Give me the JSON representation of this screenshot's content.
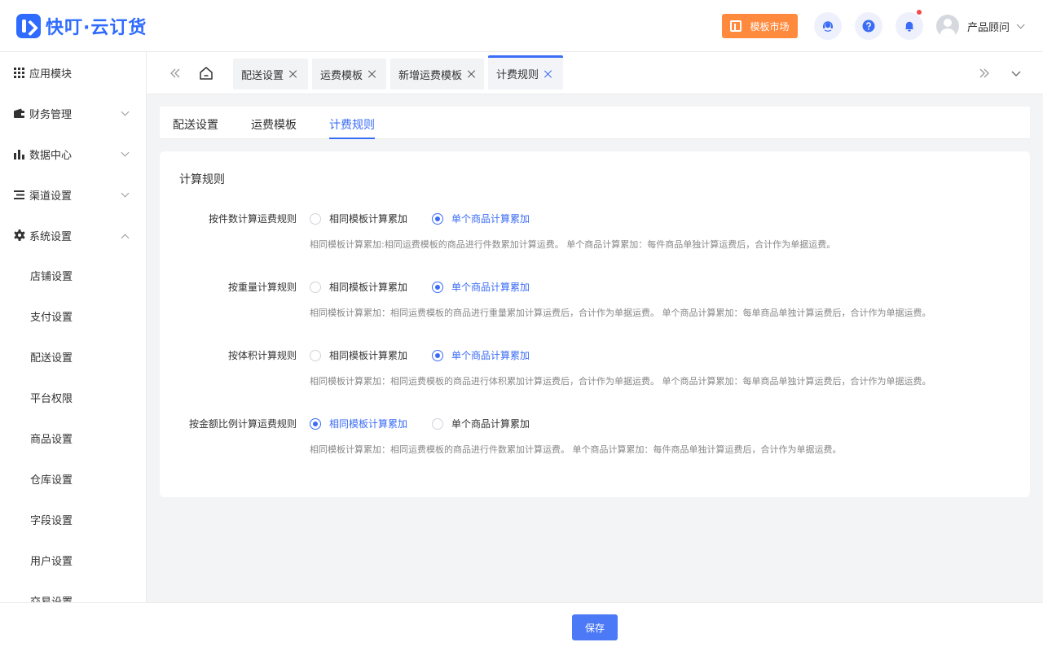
{
  "header": {
    "logo_text": "快叮·云订货",
    "market_label": "模板市场",
    "user_name": "产品顾问"
  },
  "sidebar": {
    "items": [
      {
        "label": "应用模块",
        "icon": "grid-icon"
      },
      {
        "label": "财务管理",
        "icon": "wallet-icon"
      },
      {
        "label": "数据中心",
        "icon": "bar-chart-icon"
      },
      {
        "label": "渠道设置",
        "icon": "list-icon"
      },
      {
        "label": "系统设置",
        "icon": "gear-icon"
      }
    ],
    "subitems": [
      "店铺设置",
      "支付设置",
      "配送设置",
      "平台权限",
      "商品设置",
      "仓库设置",
      "字段设置",
      "用户设置",
      "交易设置"
    ]
  },
  "tabs": [
    {
      "label": "配送设置"
    },
    {
      "label": "运费模板"
    },
    {
      "label": "新增运费模板"
    },
    {
      "label": "计费规则"
    }
  ],
  "subtabs": [
    {
      "label": "配送设置"
    },
    {
      "label": "运费模板"
    },
    {
      "label": "计费规则"
    }
  ],
  "card": {
    "title": "计算规则",
    "option_same": "相同模板计算累加",
    "option_single": "单个商品计算累加",
    "rules": [
      {
        "label": "按件数计算运费规则",
        "selected": "single",
        "hint": "相同模板计算累加:相同运费模板的商品进行件数累加计算运费。 单个商品计算累加：每件商品单独计算运费后，合计作为单据运费。"
      },
      {
        "label": "按重量计算规则",
        "selected": "single",
        "hint": "相同模板计算累加：相同运费模板的商品进行重量累加计算运费后，合计作为单据运费。 单个商品计算累加：每单商品单独计算运费后，合计作为单据运费。"
      },
      {
        "label": "按体积计算规则",
        "selected": "single",
        "hint": "相同模板计算累加：相同运费模板的商品进行体积累加计算运费后，合计作为单据运费。 单个商品计算累加：每单商品单独计算运费后，合计作为单据运费。"
      },
      {
        "label": "按金额比例计算运费规则",
        "selected": "same",
        "hint": "相同模板计算累加：相同运费模板的商品进行件数累加计算运费。 单个商品计算累加：每件商品单独计算运费后，合计作为单据运费。"
      }
    ]
  },
  "footer": {
    "save_label": "保存"
  },
  "colors": {
    "accent": "#3b6cf6",
    "market": "#ff8a3d",
    "notif": "#f5484d"
  }
}
